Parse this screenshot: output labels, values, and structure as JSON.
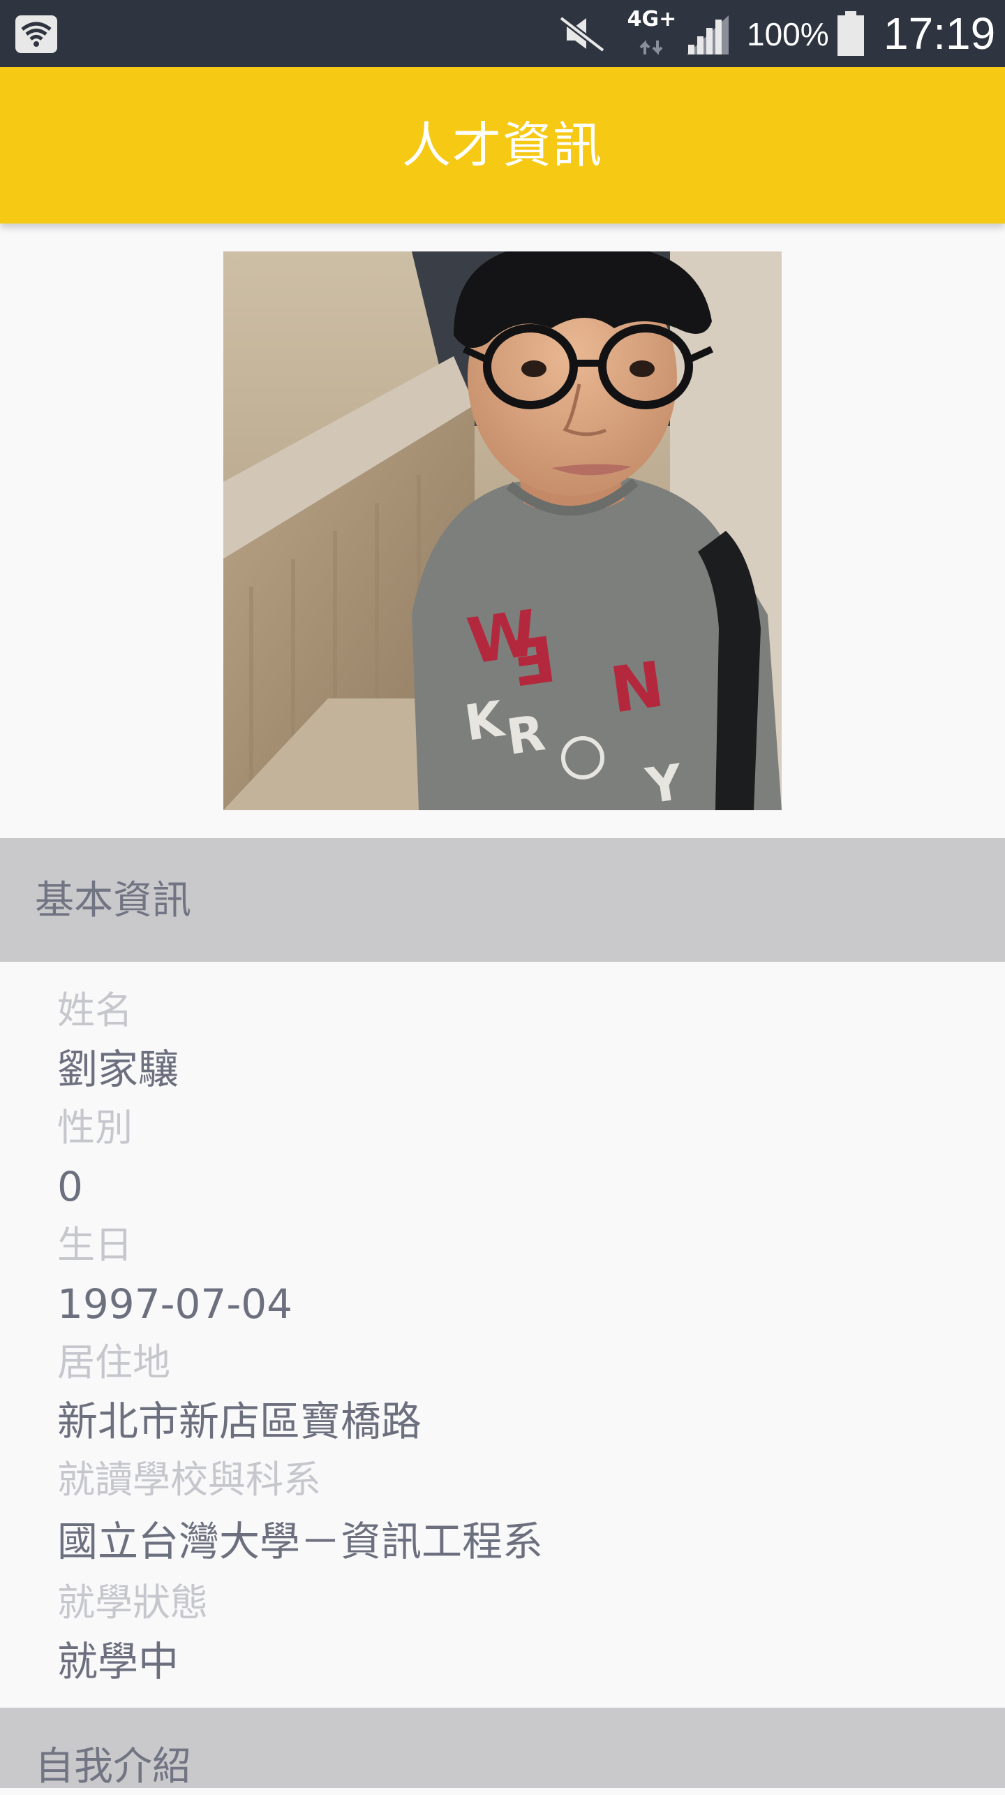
{
  "status_bar": {
    "network_type": "4G+",
    "battery_percent": "100%",
    "time": "17:19",
    "icons": [
      "wifi-icon",
      "mute-icon",
      "network-4g-icon",
      "signal-icon",
      "battery-icon"
    ]
  },
  "app_bar": {
    "title": "人才資訊"
  },
  "profile": {
    "photo_description": "profile-photo"
  },
  "basic_info": {
    "section_title": "基本資訊",
    "fields": [
      {
        "label": "姓名",
        "value": "劉家驤"
      },
      {
        "label": "性別",
        "value": "0"
      },
      {
        "label": "生日",
        "value": "1997-07-04"
      },
      {
        "label": "居住地",
        "value": "新北市新店區寶橋路"
      },
      {
        "label": "就讀學校與科系",
        "value": "國立台灣大學－資訊工程系"
      },
      {
        "label": "就學狀態",
        "value": "就學中"
      }
    ]
  },
  "self_intro": {
    "section_title": "自我介紹"
  },
  "colors": {
    "status_bar": "#2f3540",
    "app_bar": "#f5c914",
    "section_header": "#c9c9cb",
    "label_text": "#c6c7cd",
    "value_text": "#6c6f7e"
  }
}
